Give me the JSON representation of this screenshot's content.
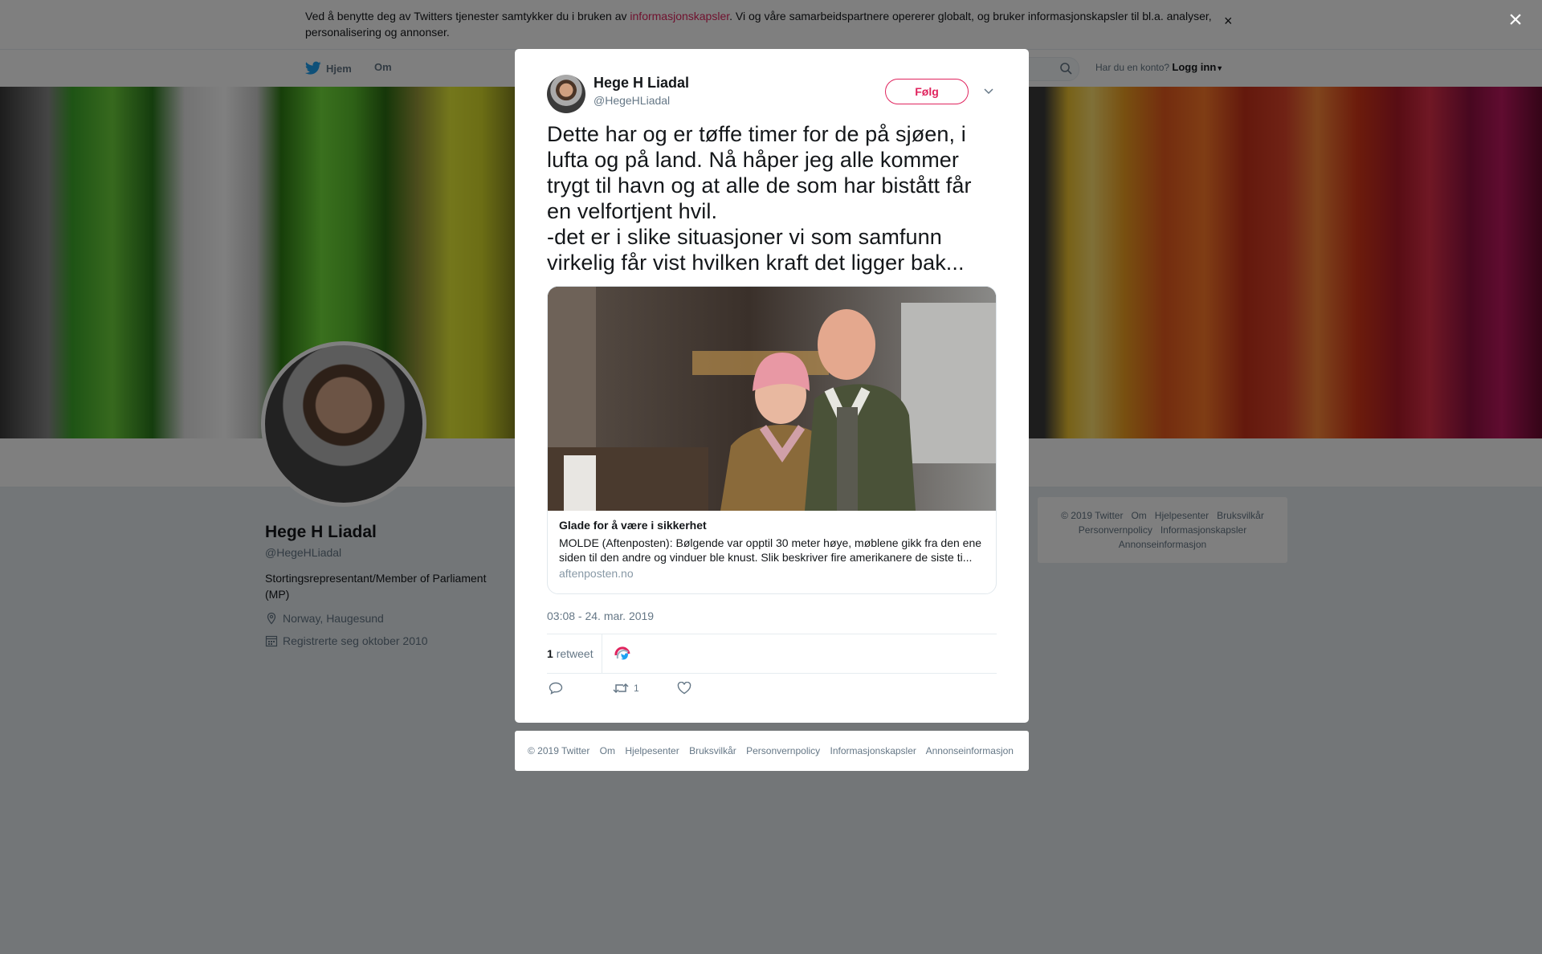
{
  "cookie_bar": {
    "text_before": "Ved å benytte deg av Twitters tjenester samtykker du i bruken av ",
    "link": "informasjonskapsler",
    "text_after": ". Vi og våre samarbeidspartnere opererer globalt, og bruker informasjonskapsler til bl.a. analyser, personalisering og annonser.",
    "close": "×"
  },
  "nav": {
    "home": "Hjem",
    "about": "Om",
    "have_account": "Har du en konto?",
    "login": "Logg inn"
  },
  "profile": {
    "name": "Hege H Liadal",
    "handle": "@HegeHLiadal",
    "bio": "Stortingsrepresentant/Member of Parliament (MP)",
    "location": "Norway, Haugesund",
    "joined": "Registrerte seg oktober 2010"
  },
  "side_footer": [
    "© 2019 Twitter",
    "Om",
    "Hjelpesenter",
    "Bruksvilkår",
    "Personvernpolicy",
    "Informasjonskapsler",
    "Annonseinformasjon"
  ],
  "overlay": {
    "close": "×"
  },
  "tweet": {
    "name": "Hege H Liadal",
    "handle": "@HegeHLiadal",
    "follow": "Følg",
    "text": "Dette har og er tøffe timer for de på sjøen, i lufta og på land. Nå håper jeg alle kommer trygt til havn og at alle de som har bistått får en velfortjent hvil.\n-det er i slike situasjoner vi som samfunn virkelig får vist hvilken kraft det ligger bak...",
    "card": {
      "title": "Glade for å være i sikkerhet",
      "description": "MOLDE (Aftenposten): Bølgende var opptil 30 meter høye, møblene gikk fra den ene siden til den andre og vinduer ble knust. Slik beskriver fire amerikanere de siste ti...",
      "domain": "aftenposten.no"
    },
    "timestamp": "03:08 - 24. mar. 2019",
    "retweet_count": "1",
    "retweet_label": "retweet",
    "actions": {
      "reply": "",
      "retweet": "1",
      "like": ""
    }
  },
  "modal_footer": [
    "© 2019 Twitter",
    "Om",
    "Hjelpesenter",
    "Bruksvilkår",
    "Personvernpolicy",
    "Informasjonskapsler",
    "Annonseinformasjon"
  ],
  "colors": {
    "accent": "#e0245e",
    "twitter_blue": "#1da1f2",
    "muted": "#657786"
  }
}
